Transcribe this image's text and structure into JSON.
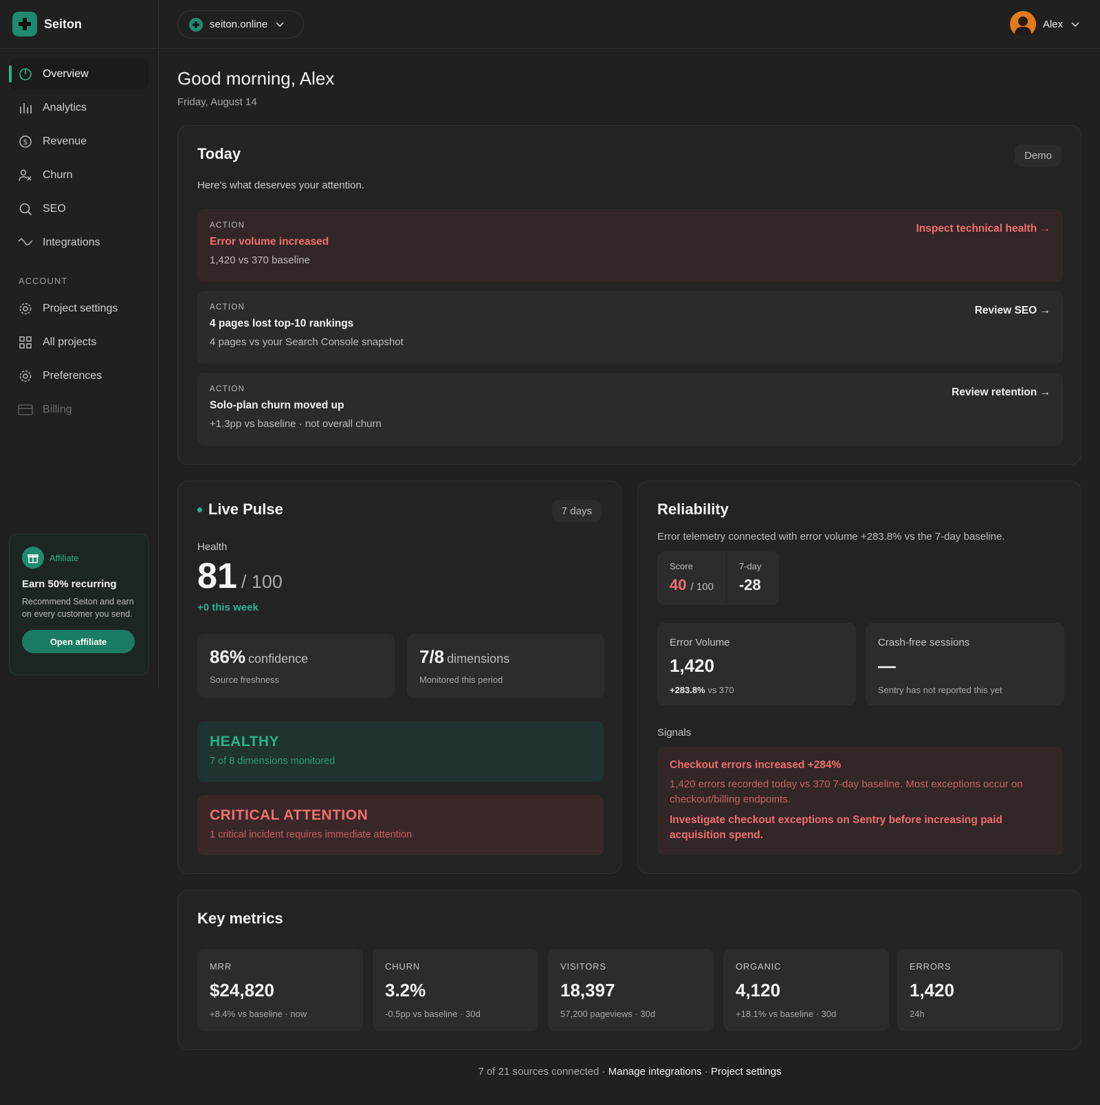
{
  "brand": {
    "name": "Seiton",
    "accent": "#1f8a6e",
    "accent_light": "#2bb28c",
    "danger": "#ef6f6f"
  },
  "topbar": {
    "project": "seiton.online",
    "user": "Alex"
  },
  "sidebar": {
    "items": [
      {
        "label": "Overview",
        "icon": "overview-icon",
        "active": true
      },
      {
        "label": "Analytics",
        "icon": "bar-chart-icon"
      },
      {
        "label": "Revenue",
        "icon": "dollar-icon"
      },
      {
        "label": "Churn",
        "icon": "user-remove-icon"
      },
      {
        "label": "SEO",
        "icon": "search-icon"
      },
      {
        "label": "Integrations",
        "icon": "plug-icon"
      }
    ],
    "account_label": "ACCOUNT",
    "account_items": [
      {
        "label": "Project settings",
        "icon": "gear-icon"
      },
      {
        "label": "All projects",
        "icon": "grid-icon"
      },
      {
        "label": "Preferences",
        "icon": "gear-icon"
      },
      {
        "label": "Billing",
        "icon": "credit-card-icon",
        "disabled": true
      }
    ],
    "affiliate": {
      "tag": "Affiliate",
      "title": "Earn 50% recurring",
      "desc": "Recommend Seiton and earn on every customer you send.",
      "button": "Open affiliate"
    }
  },
  "header": {
    "greeting": "Good morning, Alex",
    "date": "Friday, August 14"
  },
  "today": {
    "title": "Today",
    "badge": "Demo",
    "sub": "Here's what deserves your attention.",
    "actions": [
      {
        "label": "ACTION",
        "title": "Error volume increased",
        "desc": "1,420 vs 370 baseline",
        "link": "Inspect technical health →"
      },
      {
        "label": "ACTION",
        "title": "4 pages lost top-10 rankings",
        "desc": "4 pages vs your Search Console snapshot",
        "link": "Review SEO →"
      },
      {
        "label": "ACTION",
        "title": "Solo-plan churn moved up",
        "desc": "+1.3pp vs baseline · not overall churn",
        "link": "Review retention →"
      }
    ]
  },
  "pulse": {
    "title": "Live Pulse",
    "range": "7 days",
    "health_label": "Health",
    "health_value": "81",
    "health_of": "/ 100",
    "health_delta": "+0 this week",
    "confidence": {
      "value": "86%",
      "unit": "confidence",
      "desc": "Source freshness"
    },
    "dimensions": {
      "value": "7/8",
      "unit": "dimensions",
      "desc": "Monitored this period"
    },
    "healthy": {
      "title": "HEALTHY",
      "desc": "7 of 8 dimensions monitored"
    },
    "critical": {
      "title": "CRITICAL ATTENTION",
      "desc": "1 critical incident requires immediate attention"
    }
  },
  "reliability": {
    "title": "Reliability",
    "sub": "Error telemetry connected with error volume +283.8% vs the 7-day baseline.",
    "score_label": "Score",
    "score_value": "40",
    "score_of": "/ 100",
    "week_label": "7-day",
    "week_value": "-28",
    "error_volume": {
      "label": "Error Volume",
      "value": "1,420",
      "delta": "+283.8%",
      "delta_rest": "vs 370"
    },
    "crash_free": {
      "label": "Crash-free sessions",
      "value": "—",
      "desc": "Sentry has not reported this yet"
    },
    "signals_label": "Signals",
    "signal": {
      "title": "Checkout errors increased +284%",
      "body": "1,420 errors recorded today vs 370 7-day baseline. Most exceptions occur on checkout/billing endpoints.",
      "action": "Investigate checkout exceptions on Sentry before increasing paid acquisition spend."
    }
  },
  "metrics": {
    "title": "Key metrics",
    "items": [
      {
        "label": "MRR",
        "value": "$24,820",
        "desc": "+8.4% vs baseline · now"
      },
      {
        "label": "CHURN",
        "value": "3.2%",
        "desc": "-0.5pp vs baseline · 30d"
      },
      {
        "label": "VISITORS",
        "value": "18,397",
        "desc": "57,200 pageviews · 30d"
      },
      {
        "label": "ORGANIC",
        "value": "4,120",
        "desc": "+18.1% vs baseline · 30d"
      },
      {
        "label": "ERRORS",
        "value": "1,420",
        "desc": "24h"
      }
    ]
  },
  "footer": {
    "sources": "7 of 21 sources connected ·",
    "manage": "Manage integrations",
    "sep": "·",
    "settings": "Project settings"
  }
}
